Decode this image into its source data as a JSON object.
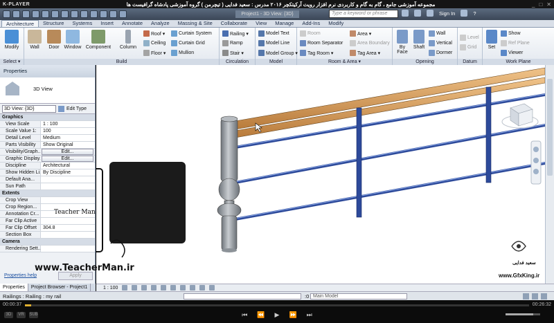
{
  "player": {
    "logo": "K-PLAYER",
    "title": "مجموعه آموزشی جامع ، گام به گام و کاربردی نرم افزار رویت آرکیتکچر ۲۰۱۶   مدرس : سعید فدایی ( تیچرمن ) گروه آموزشی پادشاه گرافیست ها",
    "window_buttons": [
      "_",
      "□",
      "✕"
    ],
    "time_elapsed": "00:00:37",
    "time_total": "00:26:32",
    "progress_fraction": 0.012,
    "controls": [
      "⏮",
      "⏪",
      "▶",
      "⏩",
      "⏭"
    ],
    "left_btns": [
      "3D",
      "VR",
      "SUB"
    ]
  },
  "app": {
    "project_title": "Project1 - 3D View: {3D}",
    "search_placeholder": "Type a keyword or phrase",
    "sign_in": "Sign In",
    "help": "?"
  },
  "tabs": [
    "Architecture",
    "Structure",
    "Systems",
    "Insert",
    "Annotate",
    "Analyze",
    "Massing & Site",
    "Collaborate",
    "View",
    "Manage",
    "Add-Ins",
    "Modify"
  ],
  "ribbon": {
    "select": {
      "modify": "Modify",
      "label": "Select ▾"
    },
    "build": {
      "wall": "Wall",
      "door": "Door",
      "window": "Window",
      "component": "Component",
      "column": "Column",
      "roof": "Roof ▾",
      "ceiling": "Ceiling",
      "floor": "Floor ▾",
      "curtain_system": "Curtain System",
      "curtain_grid": "Curtain Grid",
      "mullion": "Mullion",
      "label": "Build"
    },
    "circulation": {
      "railing": "Railing ▾",
      "ramp": "Ramp",
      "stair": "Stair ▾",
      "label": "Circulation"
    },
    "model": {
      "model_text": "Model Text",
      "model_line": "Model Line",
      "model_group": "Model Group ▾",
      "label": "Model"
    },
    "room_area": {
      "room": "Room",
      "room_separator": "Room Separator",
      "tag_room": "Tag Room ▾",
      "area": "Area ▾",
      "area_boundary": "Area Boundary",
      "tag_area": "Tag Area ▾",
      "label": "Room & Area ▾"
    },
    "opening": {
      "by_face": "By Face",
      "shaft": "Shaft",
      "wall": "Wall",
      "vertical": "Vertical",
      "dormer": "Dormer",
      "label": "Opening"
    },
    "datum": {
      "level": "Level",
      "grid": "Grid",
      "label": "Datum"
    },
    "work_plane": {
      "set": "Set",
      "show": "Show",
      "ref_plane": "Ref Plane",
      "viewer": "Viewer",
      "label": "Work Plane"
    }
  },
  "properties": {
    "title": "Properties",
    "type_name": "3D View",
    "view_selector": "3D View: {3D}",
    "edit_type": "Edit Type",
    "rows": [
      {
        "k": "Graphics",
        "v": "",
        "group": true
      },
      {
        "k": "View Scale",
        "v": "1 : 100"
      },
      {
        "k": "Scale Value    1:",
        "v": "100"
      },
      {
        "k": "Detail Level",
        "v": "Medium"
      },
      {
        "k": "Parts Visibility",
        "v": "Show Original"
      },
      {
        "k": "Visibility/Graph...",
        "v": "Edit...",
        "button": true
      },
      {
        "k": "Graphic Display...",
        "v": "Edit...",
        "button": true
      },
      {
        "k": "Discipline",
        "v": "Architectural"
      },
      {
        "k": "Show Hidden Li...",
        "v": "By Discipline"
      },
      {
        "k": "Default Ana...",
        "v": ""
      },
      {
        "k": "Sun Path",
        "v": ""
      },
      {
        "k": "Extents",
        "v": "",
        "group": true
      },
      {
        "k": "Crop View",
        "v": ""
      },
      {
        "k": "Crop Region...",
        "v": ""
      },
      {
        "k": "Annotation Cr...",
        "v": ""
      },
      {
        "k": "Far Clip Active",
        "v": ""
      },
      {
        "k": "Far Clip Offset",
        "v": "304.8"
      },
      {
        "k": "Section Box",
        "v": ""
      },
      {
        "k": "Camera",
        "v": "",
        "group": true
      },
      {
        "k": "Rendering Sett...",
        "v": ""
      }
    ],
    "help_link": "Properties help",
    "apply": "Apply",
    "tabs": [
      "Properties",
      "Project Browser - Project1"
    ]
  },
  "view_control": {
    "scale": "1 : 100"
  },
  "status": {
    "text": "Railings : Railing : my rail",
    "model": "Main Model",
    "zero": ":0"
  },
  "watermarks": {
    "teacherman_site": "www.TeacherMan.ir",
    "teacherman_name": "Teacher Man",
    "gfx_site": "www.GfxKing.ir",
    "author_fa": "سعید فدایی"
  },
  "colors": {
    "rail_wood": "#d69a55",
    "rail_steel": "#2d4a9a",
    "post": "#9aa0a6",
    "ribbon_blue": "#1b2a45"
  }
}
